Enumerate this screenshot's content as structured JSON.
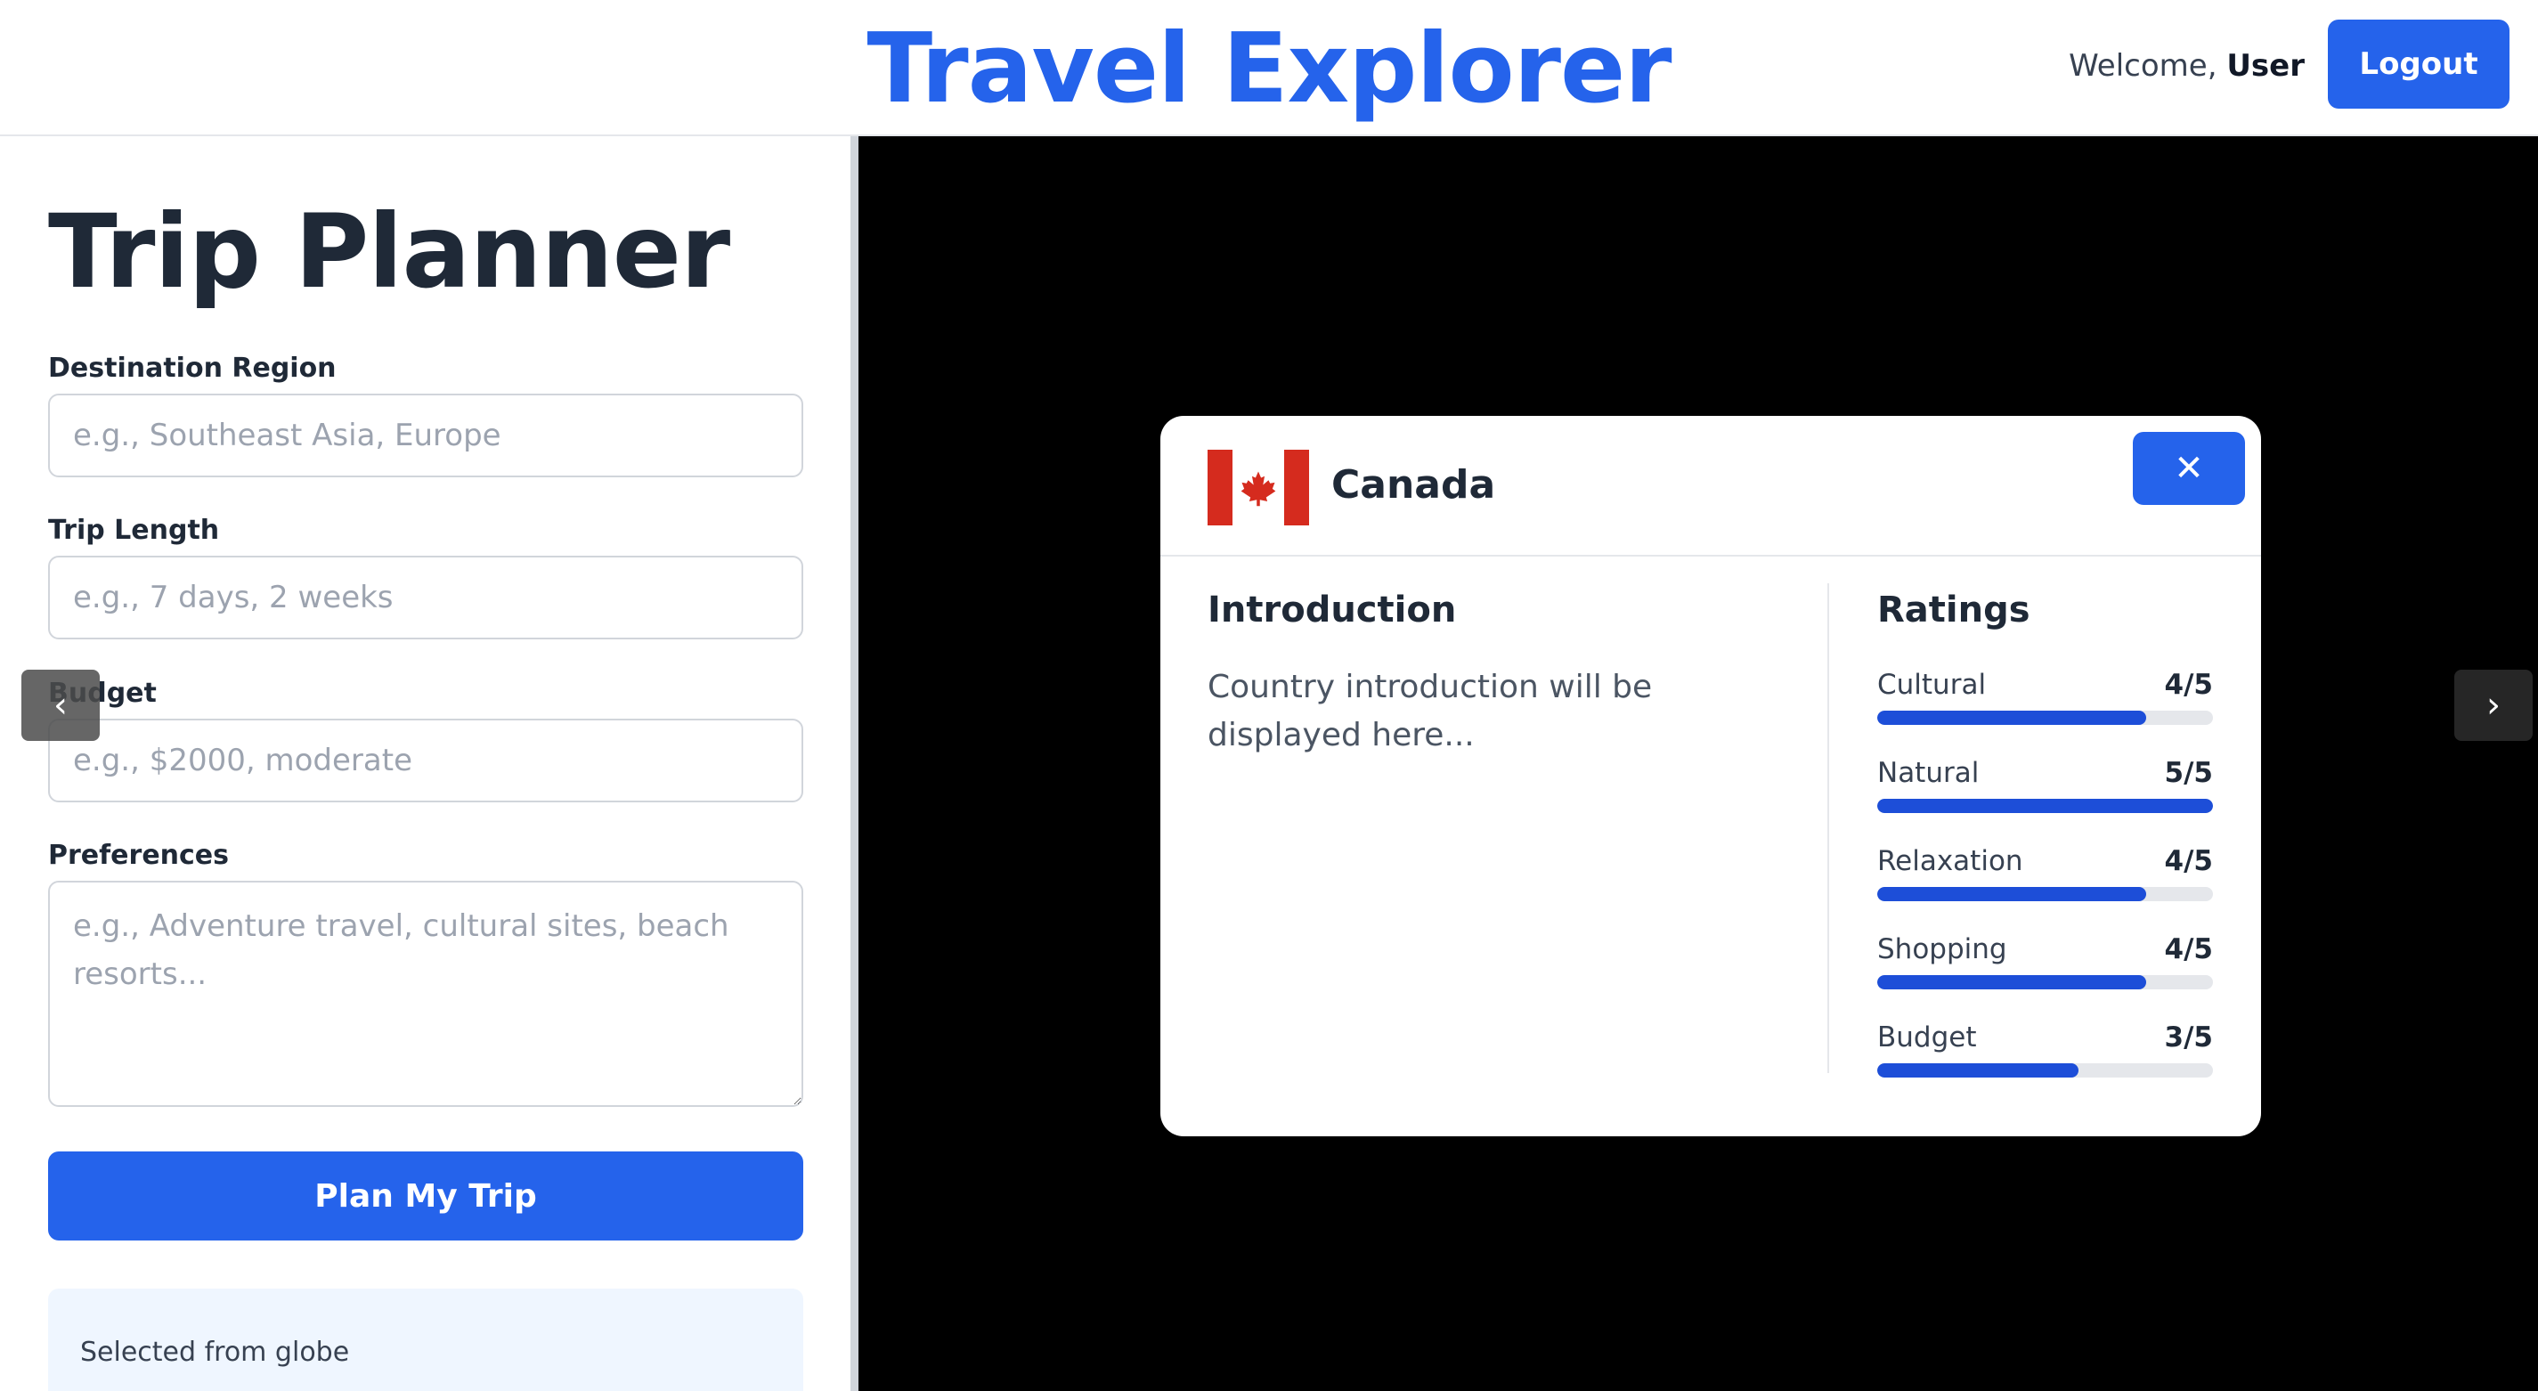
{
  "header": {
    "app_title": "Travel Explorer",
    "welcome_prefix": "Welcome, ",
    "username": "User",
    "logout_label": "Logout"
  },
  "planner": {
    "title": "Trip Planner",
    "destination": {
      "label": "Destination Region",
      "placeholder": "e.g., Southeast Asia, Europe",
      "value": ""
    },
    "trip_length": {
      "label": "Trip Length",
      "placeholder": "e.g., 7 days, 2 weeks",
      "value": ""
    },
    "budget": {
      "label": "Budget",
      "placeholder": "e.g., $2000, moderate",
      "value": ""
    },
    "preferences": {
      "label": "Preferences",
      "placeholder": "e.g., Adventure travel, cultural sites, beach resorts...",
      "value": ""
    },
    "submit_label": "Plan My Trip",
    "selected_from_globe": "Selected from globe"
  },
  "carousel": {
    "prev_icon": "‹",
    "next_icon": "›"
  },
  "modal": {
    "country": "Canada",
    "flag_icon": "canada-flag",
    "close_icon": "✕",
    "intro_heading": "Introduction",
    "intro_text": "Country introduction will be displayed here...",
    "ratings_heading": "Ratings",
    "ratings": [
      {
        "label": "Cultural",
        "score": "4/5",
        "value": 4,
        "max": 5
      },
      {
        "label": "Natural",
        "score": "5/5",
        "value": 5,
        "max": 5
      },
      {
        "label": "Relaxation",
        "score": "4/5",
        "value": 4,
        "max": 5
      },
      {
        "label": "Shopping",
        "score": "4/5",
        "value": 4,
        "max": 5
      },
      {
        "label": "Budget",
        "score": "3/5",
        "value": 3,
        "max": 5
      }
    ]
  },
  "colors": {
    "accent": "#2563eb",
    "rating_fill": "#1d4ed8",
    "flag_red": "#d52b1e",
    "globe_background": "#000000"
  }
}
